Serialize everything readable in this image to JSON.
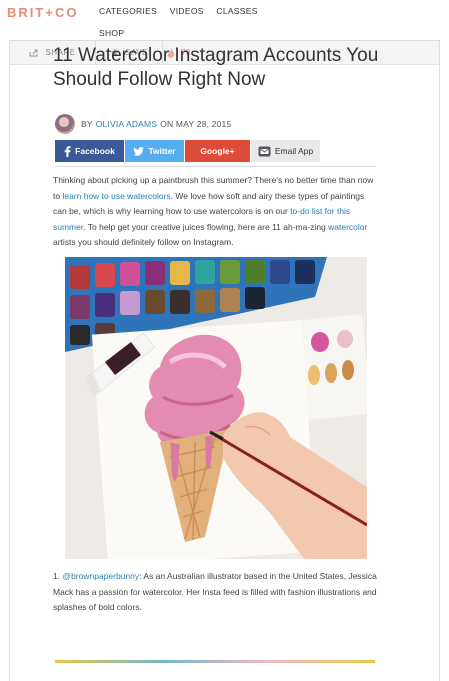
{
  "brand": {
    "logo_left": "BRIT",
    "logo_plus": "+",
    "logo_right": "CO"
  },
  "nav": {
    "items": [
      "CATEGORIES",
      "VIDEOS",
      "CLASSES"
    ],
    "shop": "SHOP"
  },
  "actions": {
    "share": "SHARE",
    "save": "SAVE",
    "count": "70"
  },
  "article": {
    "title": "11 Watercolor Instagram Accounts You Should Follow Right Now",
    "byline": {
      "by": "BY",
      "author": "OLIVIA ADAMS",
      "date": "ON MAY 28, 2015"
    },
    "social": {
      "facebook": "Facebook",
      "twitter": "Twitter",
      "google": "Google+",
      "email": "Email App"
    },
    "intro": {
      "t1": "Thinking about picking up a paintbrush this summer? There's no better time than now to ",
      "l1": "learn how to use watercolors",
      "t2": ". We love how soft and airy these types of paintings can be, which is why learning how to use watercolors is on our ",
      "l2": "to-do list for this summer",
      "t3": ". To help get your creative juices flowing, here are 11 ah-ma-zing ",
      "l3": "watercolor",
      "t4": " artists you should definitely follow on Instagram."
    },
    "item1": {
      "num": "1. ",
      "handle": "@brownpaperbunny",
      "text": ": As an Australian illustrator based in the United States, Jessica Mack has a passion for watercolor. Her Insta feed is filled with fashion illustrations and splashes of bold colors."
    }
  },
  "colors": {
    "accent": "#e58b76",
    "link": "#2a7fb3",
    "facebook": "#3b5998",
    "twitter": "#55acee",
    "google": "#dd4b39"
  }
}
